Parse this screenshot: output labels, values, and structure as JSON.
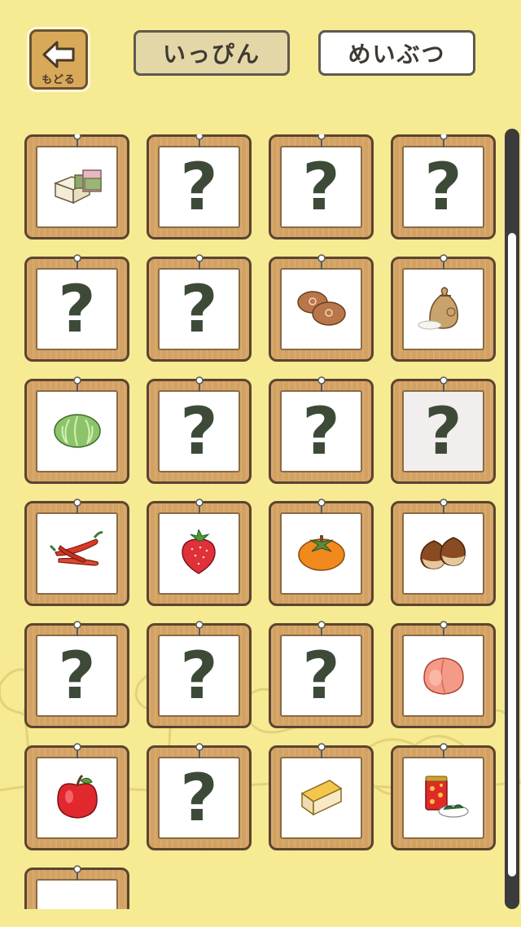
{
  "header": {
    "back_label": "もどる",
    "tab_items_label": "いっぴん",
    "tab_specialties_label": "めいぶつ"
  },
  "grid": {
    "unknown_mark": "?",
    "cards": [
      {
        "item": "mochi-sweets-icon",
        "unlocked": true
      },
      {
        "item": "unknown",
        "unlocked": false
      },
      {
        "item": "unknown",
        "unlocked": false
      },
      {
        "item": "unknown",
        "unlocked": false
      },
      {
        "item": "unknown",
        "unlocked": false
      },
      {
        "item": "unknown",
        "unlocked": false
      },
      {
        "item": "manju-buns-icon",
        "unlocked": true
      },
      {
        "item": "rice-sack-icon",
        "unlocked": true
      },
      {
        "item": "cabbage-icon",
        "unlocked": true
      },
      {
        "item": "unknown",
        "unlocked": false
      },
      {
        "item": "unknown",
        "unlocked": false
      },
      {
        "item": "unknown",
        "unlocked": false
      },
      {
        "item": "chili-peppers-icon",
        "unlocked": true
      },
      {
        "item": "strawberry-icon",
        "unlocked": true
      },
      {
        "item": "persimmon-icon",
        "unlocked": true
      },
      {
        "item": "chestnuts-icon",
        "unlocked": true
      },
      {
        "item": "unknown",
        "unlocked": false
      },
      {
        "item": "unknown",
        "unlocked": false
      },
      {
        "item": "unknown",
        "unlocked": false
      },
      {
        "item": "peach-icon",
        "unlocked": true
      },
      {
        "item": "apple-icon",
        "unlocked": true
      },
      {
        "item": "unknown",
        "unlocked": false
      },
      {
        "item": "cheese-icon",
        "unlocked": true
      },
      {
        "item": "tea-can-icon",
        "unlocked": true
      },
      {
        "item": "partial-item-icon",
        "unlocked": true
      }
    ]
  },
  "colors": {
    "background": "#f6ea93",
    "frame": "#d3a262",
    "frame_border": "#5c4430",
    "question_mark": "#3d4a38"
  }
}
